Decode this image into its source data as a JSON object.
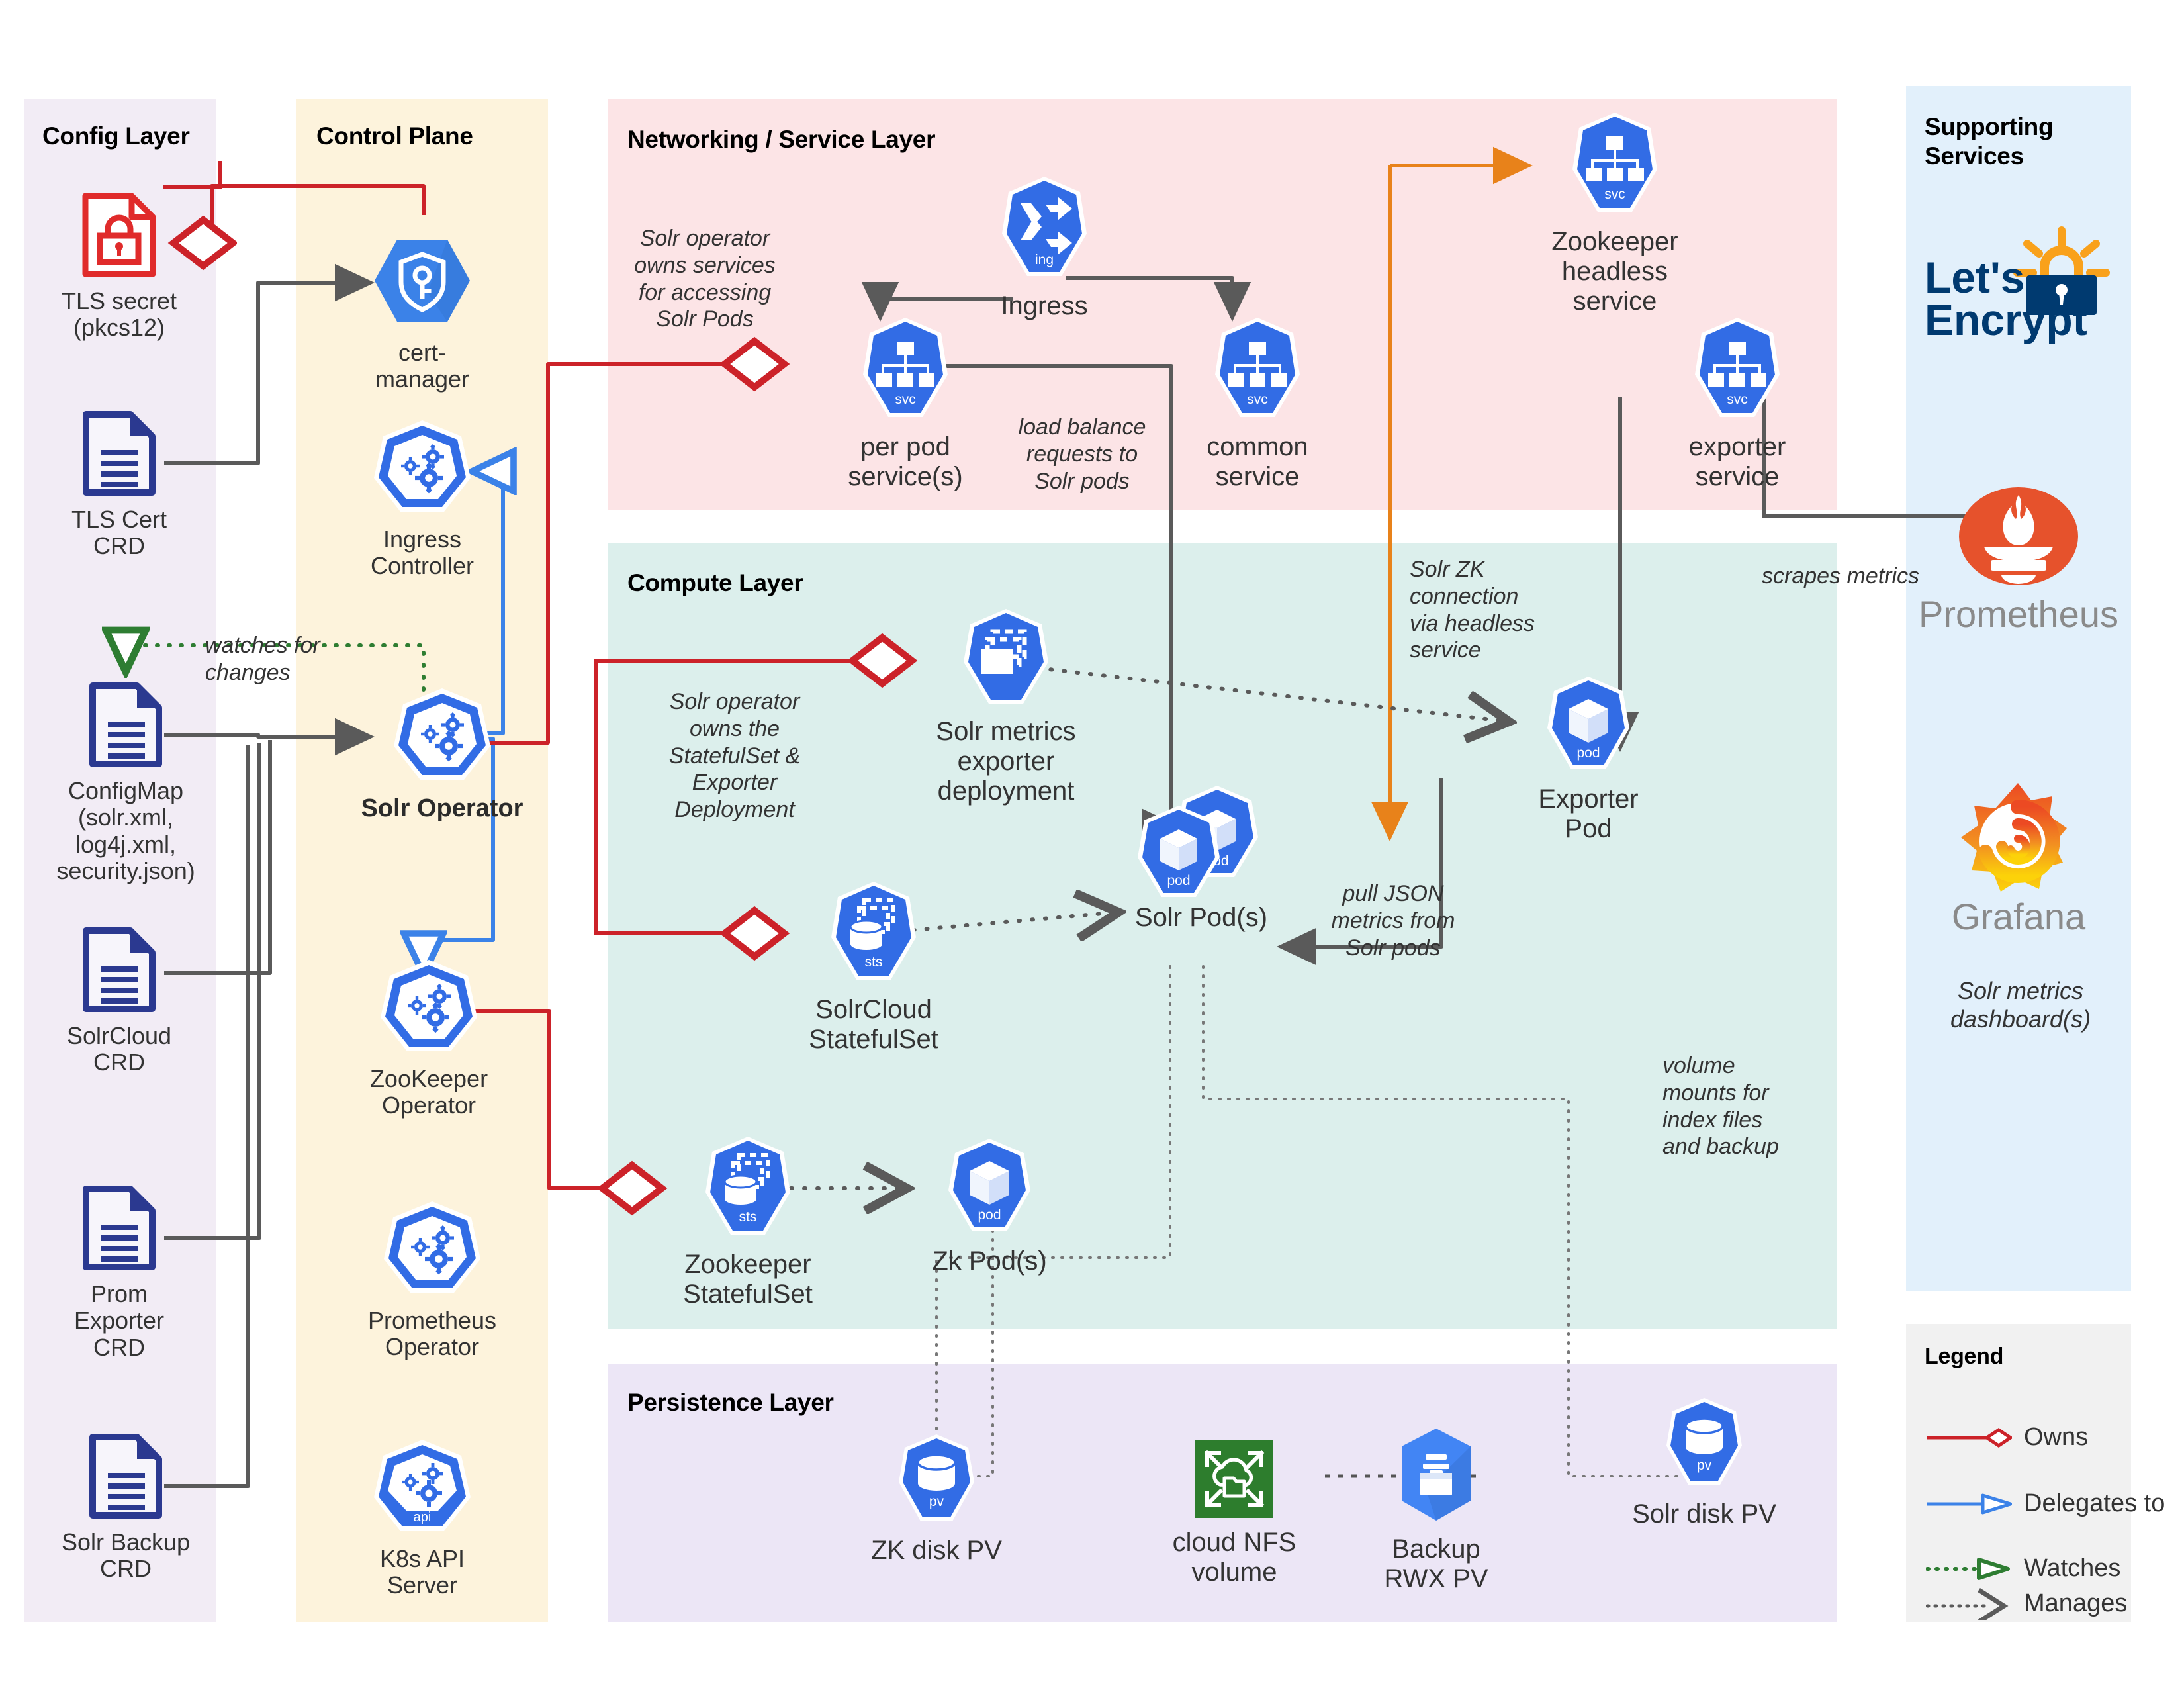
{
  "panels": {
    "config": {
      "title": "Config Layer",
      "color": "#f2ecf5"
    },
    "control": {
      "title": "Control Plane",
      "color": "#fdf3dc"
    },
    "networking": {
      "title": "Networking / Service Layer",
      "color": "#fce4e6"
    },
    "compute": {
      "title": "Compute Layer",
      "color": "#dcefec"
    },
    "persistence": {
      "title": "Persistence Layer",
      "color": "#ece6f6"
    },
    "supporting": {
      "title": "Supporting\nServices",
      "color": "#e2f0fb"
    },
    "legend": {
      "title": "Legend",
      "color": "#f1f1f1"
    }
  },
  "config_layer": {
    "nodes": [
      {
        "label": "TLS secret\n(pkcs12)",
        "icon": "secret-doc-lock-icon",
        "badge": ""
      },
      {
        "label": "TLS Cert\nCRD",
        "icon": "document-icon",
        "badge": ""
      },
      {
        "label": "ConfigMap\n(solr.xml,\nlog4j.xml,\nsecurity.json)",
        "icon": "document-icon",
        "badge": ""
      },
      {
        "label": "SolrCloud\nCRD",
        "icon": "document-icon",
        "badge": ""
      },
      {
        "label": "Prom\nExporter\nCRD",
        "icon": "document-icon",
        "badge": ""
      },
      {
        "label": "Solr Backup\nCRD",
        "icon": "document-icon",
        "badge": ""
      }
    ]
  },
  "control_plane": {
    "nodes": [
      {
        "label": "cert-manager",
        "icon": "cert-manager-shield-key-icon",
        "badge": "",
        "bold": false
      },
      {
        "label": "Ingress\nController",
        "icon": "k8s-gears-icon",
        "badge": "",
        "bold": false
      },
      {
        "label": "Solr Operator",
        "icon": "k8s-gears-icon",
        "badge": "",
        "bold": true
      },
      {
        "label": "ZooKeeper\nOperator",
        "icon": "k8s-gears-icon",
        "badge": "",
        "bold": false
      },
      {
        "label": "Prometheus\nOperator",
        "icon": "k8s-gears-icon",
        "badge": "",
        "bold": false
      },
      {
        "label": "K8s API\nServer",
        "icon": "k8s-gears-icon",
        "badge": "api",
        "bold": false
      }
    ]
  },
  "networking_layer": {
    "nodes": [
      {
        "label": "Ingress",
        "icon": "k8s-ingress-icon",
        "badge": "ing"
      },
      {
        "label": "per pod\nservice(s)",
        "icon": "k8s-service-icon",
        "badge": "svc"
      },
      {
        "label": "common\nservice",
        "icon": "k8s-service-icon",
        "badge": "svc"
      },
      {
        "label": "Zookeeper\nheadless\nservice",
        "icon": "k8s-service-icon",
        "badge": "svc"
      },
      {
        "label": "exporter\nservice",
        "icon": "k8s-service-icon",
        "badge": "svc"
      }
    ],
    "notes": [
      "Solr operator\nowns services\nfor accessing\nSolr Pods",
      "load balance\nrequests to\nSolr pods",
      "Solr ZK\nconnection\nvia headless\nservice"
    ]
  },
  "compute_layer": {
    "nodes": [
      {
        "label": "Solr metrics\nexporter\ndeployment",
        "icon": "k8s-deployment-icon",
        "badge": ""
      },
      {
        "label": "SolrCloud\nStatefulSet",
        "icon": "k8s-statefulset-icon",
        "badge": "sts"
      },
      {
        "label": "Solr Pod(s)",
        "icon": "k8s-pod-stack-icon",
        "badge": "pod"
      },
      {
        "label": "Exporter Pod",
        "icon": "k8s-pod-icon",
        "badge": "pod"
      },
      {
        "label": "Zookeeper\nStatefulSet",
        "icon": "k8s-statefulset-icon",
        "badge": "sts"
      },
      {
        "label": "Zk Pod(s)",
        "icon": "k8s-pod-icon",
        "badge": "pod"
      }
    ],
    "notes": [
      "Solr operator\nowns the\nStatefulSet &\nExporter\nDeployment",
      "pull JSON\nmetrics from\nSolr pods",
      "volume\nmounts for\nindex files\nand backup"
    ]
  },
  "persistence_layer": {
    "nodes": [
      {
        "label": "ZK disk PV",
        "icon": "k8s-pv-icon",
        "badge": "pv"
      },
      {
        "label": "cloud NFS\nvolume",
        "icon": "cloud-nfs-filestore-icon",
        "badge": ""
      },
      {
        "label": "Backup\nRWX PV",
        "icon": "backup-archive-icon",
        "badge": ""
      },
      {
        "label": "Solr disk PV",
        "icon": "k8s-pv-icon",
        "badge": "pv"
      }
    ]
  },
  "supporting_services": {
    "items": [
      {
        "label": "Let's\nEncrypt",
        "icon": "lets-encrypt-logo"
      },
      {
        "label": "Prometheus",
        "icon": "prometheus-logo"
      },
      {
        "label": "Grafana",
        "icon": "grafana-logo"
      }
    ],
    "note": "Solr metrics\ndashboard(s)"
  },
  "edge_labels": {
    "watches_for_changes": "watches for\nchanges",
    "scrapes_metrics": "scrapes metrics"
  },
  "legend": {
    "items": [
      {
        "label": "Owns",
        "style": "solid",
        "color": "#cc2229",
        "marker": "diamond"
      },
      {
        "label": "Delegates to",
        "style": "solid",
        "color": "#3b82e8",
        "marker": "open-arrow"
      },
      {
        "label": "Watches",
        "style": "dotted",
        "color": "#2e7d32",
        "marker": "open-arrow"
      },
      {
        "label": "Manages",
        "style": "dotted",
        "color": "#5a5a5a",
        "marker": "chevron"
      }
    ]
  },
  "colors": {
    "k8s_blue": "#326ce5",
    "owns_red": "#cc2229",
    "delegates_blue": "#3b82e8",
    "watches_green": "#2e7d32",
    "manages_gray": "#5a5a5a",
    "zk_orange": "#e8821a",
    "doc_navy": "#2b3990",
    "nfs_green": "#2d7d2d",
    "prometheus_orange": "#e6522c",
    "lets_encrypt_navy": "#003a70",
    "lets_encrypt_gold": "#f9a11b"
  }
}
